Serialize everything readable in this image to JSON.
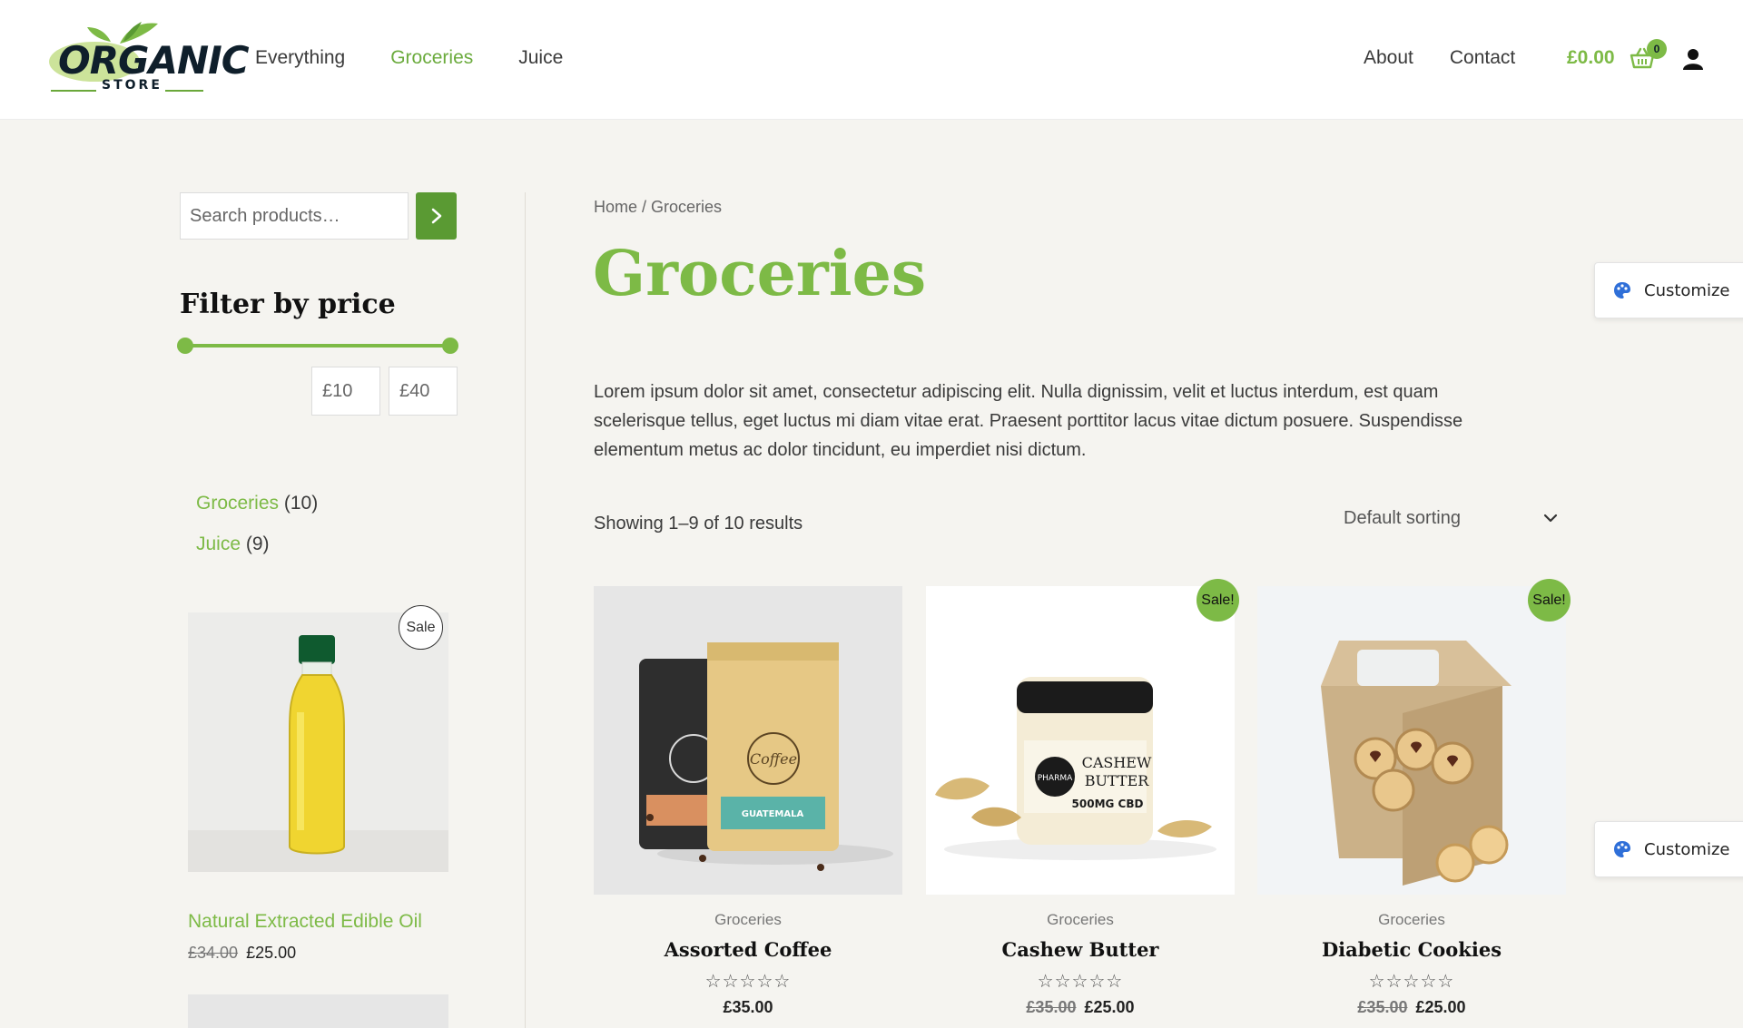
{
  "header": {
    "logo_main": "ORGANIC",
    "logo_sub": "STORE",
    "nav": [
      "Everything",
      "Groceries",
      "Juice"
    ],
    "nav_active": "Groceries",
    "nav_right": [
      "About",
      "Contact"
    ],
    "cart_total": "£0.00",
    "cart_count": "0",
    "accent_color": "#7dba46"
  },
  "sidebar": {
    "search_placeholder": "Search products…",
    "filter_title": "Filter by price",
    "price_min": "£10",
    "price_max": "£40",
    "categories": [
      {
        "name": "Groceries",
        "count": "(10)"
      },
      {
        "name": "Juice",
        "count": "(9)"
      }
    ],
    "featured": {
      "badge": "Sale",
      "name": "Natural Extracted Edible Oil",
      "old_price": "£34.00",
      "price": "£25.00"
    }
  },
  "main": {
    "breadcrumb": "Home / Groceries",
    "title": "Groceries",
    "description": "Lorem ipsum dolor sit amet, consectetur adipiscing elit. Nulla dignissim, velit et luctus interdum, est quam scelerisque tellus, eget luctus mi diam vitae erat. Praesent porttitor lacus vitae dictum posuere. Suspendisse elementum metus ac dolor tincidunt, eu imperdiet nisi dictum.",
    "result_count": "Showing 1–9 of 10 results",
    "sort_label": "Default sorting",
    "products": [
      {
        "category": "Groceries",
        "name": "Assorted Coffee",
        "stars": "☆☆☆☆☆",
        "old_price": "",
        "price": "£35.00",
        "sale": ""
      },
      {
        "category": "Groceries",
        "name": "Cashew Butter",
        "stars": "☆☆☆☆☆",
        "old_price": "£35.00",
        "price": "£25.00",
        "sale": "Sale!"
      },
      {
        "category": "Groceries",
        "name": "Diabetic Cookies",
        "stars": "☆☆☆☆☆",
        "old_price": "£35.00",
        "price": "£25.00",
        "sale": "Sale!"
      }
    ],
    "jar_label": [
      "PHARMA",
      "CASHEW",
      "BUTTER",
      "500MG CBD"
    ],
    "coffee_label": [
      "Coffee",
      "GUATEMALA"
    ]
  },
  "customize": {
    "label": "Customize",
    "icon": "palette-icon"
  }
}
